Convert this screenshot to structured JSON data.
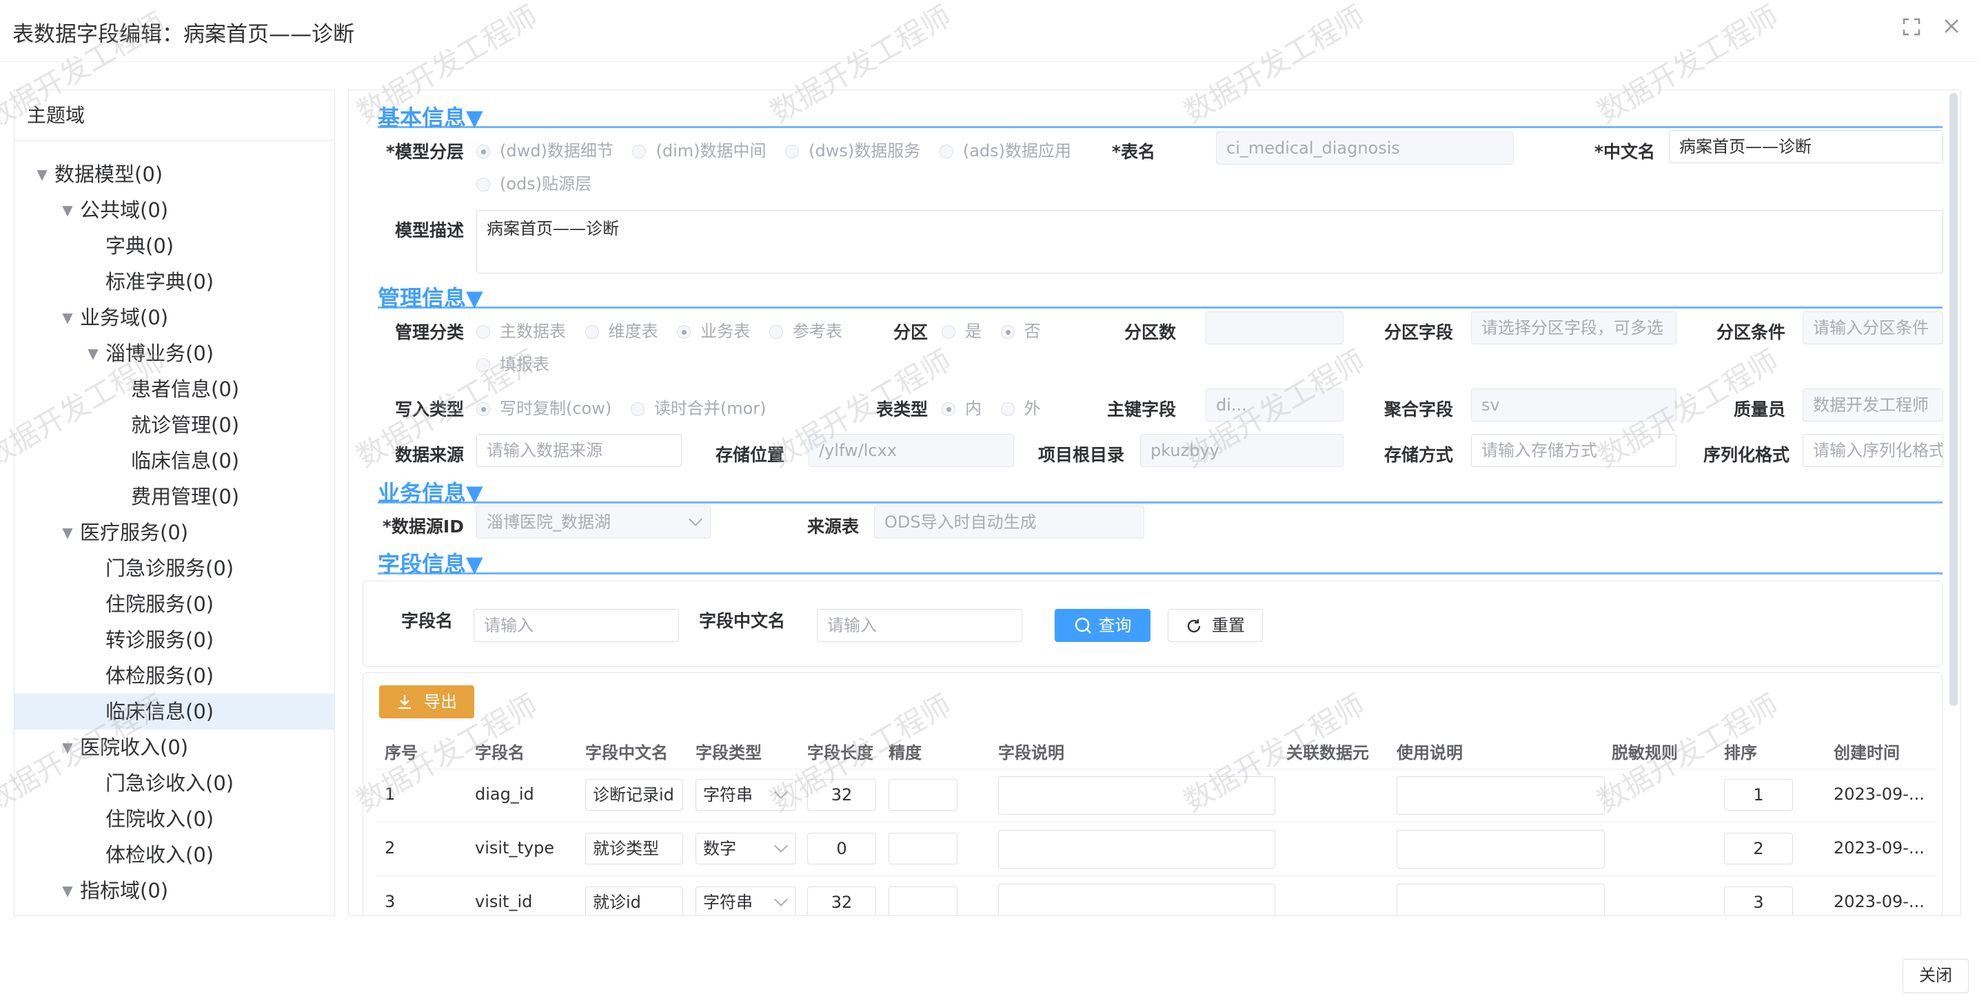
{
  "dialog": {
    "title": "表数据字段编辑：病案首页——诊断",
    "close_label": "关闭"
  },
  "tree": {
    "title": "主题域",
    "nodes": [
      {
        "label": "数据模型(0)",
        "level": 0,
        "expanded": true
      },
      {
        "label": "公共域(0)",
        "level": 1,
        "expanded": true
      },
      {
        "label": "字典(0)",
        "level": 2
      },
      {
        "label": "标准字典(0)",
        "level": 2
      },
      {
        "label": "业务域(0)",
        "level": 1,
        "expanded": true
      },
      {
        "label": "淄博业务(0)",
        "level": 2,
        "expanded": true
      },
      {
        "label": "患者信息(0)",
        "level": 3
      },
      {
        "label": "就诊管理(0)",
        "level": 3
      },
      {
        "label": "临床信息(0)",
        "level": 3
      },
      {
        "label": "费用管理(0)",
        "level": 3
      },
      {
        "label": "医疗服务(0)",
        "level": 1,
        "expanded": true
      },
      {
        "label": "门急诊服务(0)",
        "level": 2
      },
      {
        "label": "住院服务(0)",
        "level": 2
      },
      {
        "label": "转诊服务(0)",
        "level": 2
      },
      {
        "label": "体检服务(0)",
        "level": 2
      },
      {
        "label": "临床信息(0)",
        "level": 2,
        "active": true
      },
      {
        "label": "医院收入(0)",
        "level": 1,
        "expanded": true
      },
      {
        "label": "门急诊收入(0)",
        "level": 2
      },
      {
        "label": "住院收入(0)",
        "level": 2
      },
      {
        "label": "体检收入(0)",
        "level": 2
      },
      {
        "label": "指标域(0)",
        "level": 1,
        "expanded": true
      }
    ]
  },
  "basic": {
    "section": "基本信息▼",
    "layer_label": "*模型分层",
    "layer_options": [
      "(dwd)数据细节",
      "(dim)数据中间",
      "(dws)数据服务",
      "(ads)数据应用",
      "(ods)贴源层"
    ],
    "table_label": "*表名",
    "table_value": "ci_medical_diagnosis",
    "cn_label": "*中文名",
    "cn_value": "病案首页——诊断",
    "desc_label": "模型描述",
    "desc_value": "病案首页——诊断"
  },
  "manage": {
    "section": "管理信息▼",
    "cat_label": "管理分类",
    "cat_options": [
      "主数据表",
      "维度表",
      "业务表",
      "参考表",
      "填报表"
    ],
    "part_label": "分区",
    "part_options": [
      "是",
      "否"
    ],
    "part_count_label": "分区数",
    "part_count_value": "",
    "part_field_label": "分区字段",
    "part_field_ph": "请选择分区字段，可多选",
    "part_cond_label": "分区条件",
    "part_cond_ph": "请输入分区条件",
    "write_label": "写入类型",
    "write_options": [
      "写时复制(cow)",
      "读时合并(mor)"
    ],
    "ttype_label": "表类型",
    "ttype_options": [
      "内",
      "外"
    ],
    "pk_label": "主键字段",
    "pk_value": "di...",
    "agg_label": "聚合字段",
    "agg_value": "sv",
    "qc_label": "质量员",
    "qc_value": "数据开发工程师",
    "src_label": "数据来源",
    "src_ph": "请输入数据来源",
    "loc_label": "存储位置",
    "loc_value": "/ylfw/lcxx",
    "root_label": "项目根目录",
    "root_value": "pkuzbyy",
    "store_label": "存储方式",
    "store_ph": "请输入存储方式",
    "ser_label": "序列化格式",
    "ser_ph": "请输入序列化格式"
  },
  "business": {
    "section": "业务信息▼",
    "ds_label": "*数据源ID",
    "ds_value": "淄博医院_数据湖",
    "srctable_label": "来源表",
    "srctable_value": "ODS导入时自动生成"
  },
  "fields": {
    "section": "字段信息▼",
    "name_label": "字段名",
    "name_ph": "请输入",
    "cn_label": "字段中文名",
    "cn_ph": "请输入",
    "query_label": "查询",
    "reset_label": "重置",
    "export_label": "导出",
    "columns": [
      "序号",
      "字段名",
      "字段中文名",
      "字段类型",
      "字段长度",
      "精度",
      "字段说明",
      "关联数据元",
      "使用说明",
      "脱敏规则",
      "排序",
      "创建时间"
    ],
    "rows": [
      {
        "no": "1",
        "name": "diag_id",
        "cn": "诊断记录id",
        "type": "字符串",
        "len": "32",
        "prec": "",
        "order": "1",
        "created": "2023-09-..."
      },
      {
        "no": "2",
        "name": "visit_type",
        "cn": "就诊类型",
        "type": "数字",
        "len": "0",
        "prec": "",
        "order": "2",
        "created": "2023-09-..."
      },
      {
        "no": "3",
        "name": "visit_id",
        "cn": "就诊id",
        "type": "字符串",
        "len": "32",
        "prec": "",
        "order": "3",
        "created": "2023-09-..."
      }
    ]
  },
  "watermark": "数据开发工程师"
}
